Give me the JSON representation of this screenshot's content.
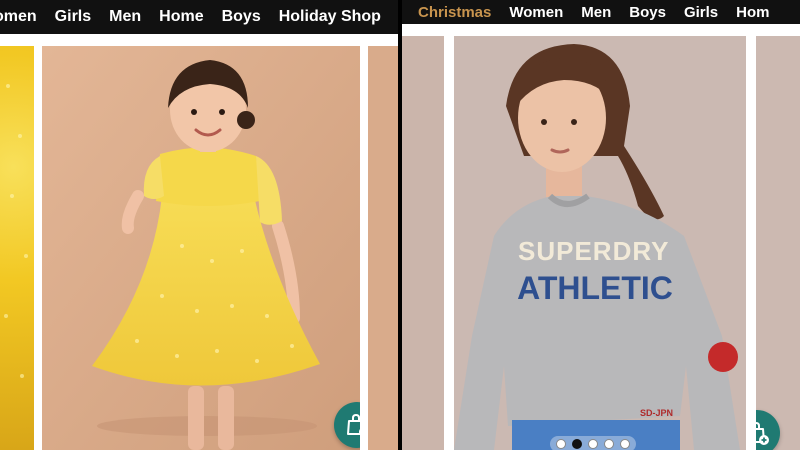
{
  "left_screen": {
    "nav": {
      "items": [
        {
          "label": "omen",
          "active": false
        },
        {
          "label": "Girls",
          "active": false
        },
        {
          "label": "Men",
          "active": false
        },
        {
          "label": "Home",
          "active": false
        },
        {
          "label": "Boys",
          "active": false
        },
        {
          "label": "Holiday Shop",
          "active": false
        }
      ]
    },
    "product_image": {
      "subject": "girl in yellow tulle dress"
    },
    "bag_icon": "shopping-bag-plus-icon"
  },
  "right_screen": {
    "nav": {
      "items": [
        {
          "label": "Christmas",
          "active": true
        },
        {
          "label": "Women",
          "active": false
        },
        {
          "label": "Men",
          "active": false
        },
        {
          "label": "Boys",
          "active": false
        },
        {
          "label": "Girls",
          "active": false
        },
        {
          "label": "Hom",
          "active": false
        }
      ]
    },
    "product_image": {
      "subject": "girl in grey athletic sweatshirt",
      "print_top": "SUPERDRY",
      "print_main": "ATHLETIC",
      "hem_tag": "SD-JPN"
    },
    "carousel": {
      "dot_count": 5,
      "active_index": 1
    },
    "bag_icon": "shopping-bag-plus-icon"
  },
  "colors": {
    "nav_bg": "#111111",
    "nav_active": "#c8944e",
    "bag_button": "#1f7a72"
  }
}
